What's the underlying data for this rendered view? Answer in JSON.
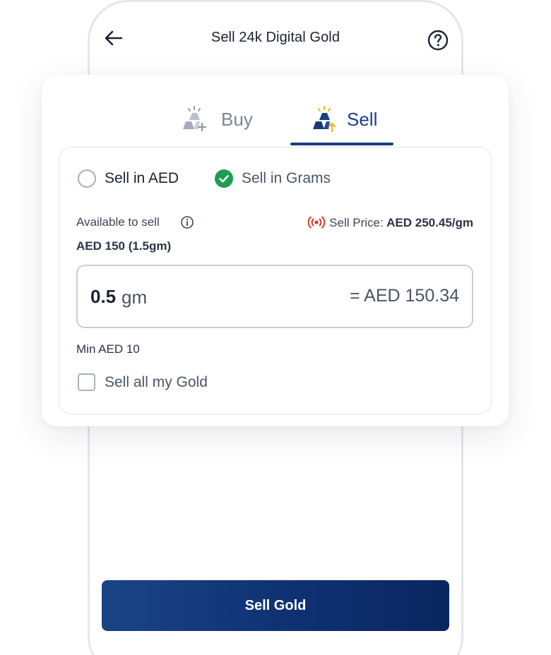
{
  "header": {
    "title": "Sell 24k Digital Gold",
    "back_icon": "arrow-left-icon",
    "help_icon": "question-circle-icon"
  },
  "tabs": [
    {
      "label": "Buy",
      "icon": "gold-bars-plus-icon",
      "active": false
    },
    {
      "label": "Sell",
      "icon": "gold-bars-arrow-up-icon",
      "active": true
    }
  ],
  "mode": {
    "options": [
      {
        "label": "Sell in AED",
        "selected": false
      },
      {
        "label": "Sell in Grams",
        "selected": true
      }
    ]
  },
  "available": {
    "label": "Available to sell",
    "value": "AED 150 (1.5gm)"
  },
  "price": {
    "label": "Sell Price:",
    "value": "AED 250.45/gm"
  },
  "amount": {
    "value": "0.5",
    "unit": "gm",
    "equivalent": "= AED 150.34"
  },
  "min_label": "Min AED 10",
  "sell_all": {
    "label": "Sell all my Gold",
    "checked": false
  },
  "action": {
    "label": "Sell Gold"
  },
  "colors": {
    "primary": "#15407e",
    "success": "#1f9d4f",
    "live": "#d93a2b",
    "gold": "#f0b21c"
  }
}
